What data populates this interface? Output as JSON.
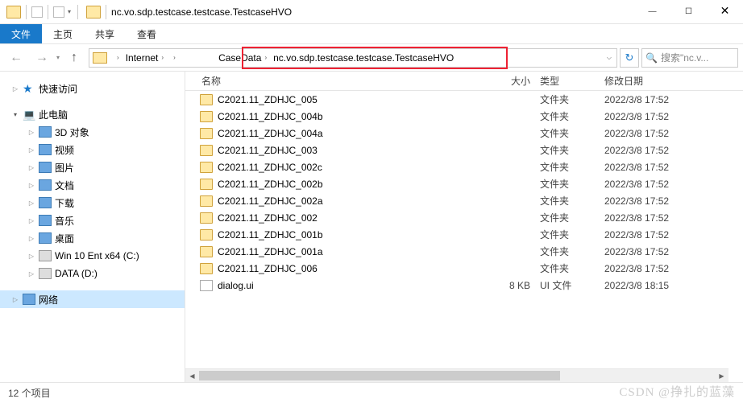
{
  "title": "nc.vo.sdp.testcase.testcase.TestcaseHVO",
  "ribbon": {
    "file": "文件",
    "home": "主页",
    "share": "共享",
    "view": "查看"
  },
  "breadcrumbs": {
    "internet": "Internet",
    "caseData": "CaseData",
    "testcase": "nc.vo.sdp.testcase.testcase.TestcaseHVO"
  },
  "search": {
    "placeholder": "搜索\"nc.v..."
  },
  "sidebar": {
    "quick": "快速访问",
    "pc": "此电脑",
    "items": [
      {
        "label": "3D 对象"
      },
      {
        "label": "视频"
      },
      {
        "label": "图片"
      },
      {
        "label": "文档"
      },
      {
        "label": "下载"
      },
      {
        "label": "音乐"
      },
      {
        "label": "桌面"
      },
      {
        "label": "Win 10 Ent x64 (C:)"
      },
      {
        "label": "DATA (D:)"
      }
    ],
    "network": "网络"
  },
  "headers": {
    "name": "名称",
    "size": "大小",
    "type": "类型",
    "date": "修改日期"
  },
  "files": [
    {
      "name": "C2021.11_ZDHJC_005",
      "size": "",
      "type": "文件夹",
      "date": "2022/3/8 17:52",
      "kind": "fldr"
    },
    {
      "name": "C2021.11_ZDHJC_004b",
      "size": "",
      "type": "文件夹",
      "date": "2022/3/8 17:52",
      "kind": "fldr"
    },
    {
      "name": "C2021.11_ZDHJC_004a",
      "size": "",
      "type": "文件夹",
      "date": "2022/3/8 17:52",
      "kind": "fldr"
    },
    {
      "name": "C2021.11_ZDHJC_003",
      "size": "",
      "type": "文件夹",
      "date": "2022/3/8 17:52",
      "kind": "fldr"
    },
    {
      "name": "C2021.11_ZDHJC_002c",
      "size": "",
      "type": "文件夹",
      "date": "2022/3/8 17:52",
      "kind": "fldr"
    },
    {
      "name": "C2021.11_ZDHJC_002b",
      "size": "",
      "type": "文件夹",
      "date": "2022/3/8 17:52",
      "kind": "fldr"
    },
    {
      "name": "C2021.11_ZDHJC_002a",
      "size": "",
      "type": "文件夹",
      "date": "2022/3/8 17:52",
      "kind": "fldr"
    },
    {
      "name": "C2021.11_ZDHJC_002",
      "size": "",
      "type": "文件夹",
      "date": "2022/3/8 17:52",
      "kind": "fldr"
    },
    {
      "name": "C2021.11_ZDHJC_001b",
      "size": "",
      "type": "文件夹",
      "date": "2022/3/8 17:52",
      "kind": "fldr"
    },
    {
      "name": "C2021.11_ZDHJC_001a",
      "size": "",
      "type": "文件夹",
      "date": "2022/3/8 17:52",
      "kind": "fldr"
    },
    {
      "name": "C2021.11_ZDHJC_006",
      "size": "",
      "type": "文件夹",
      "date": "2022/3/8 17:52",
      "kind": "fldr"
    },
    {
      "name": "dialog.ui",
      "size": "8 KB",
      "type": "UI 文件",
      "date": "2022/3/8 18:15",
      "kind": "file"
    }
  ],
  "status": "12 个项目",
  "watermark": "CSDN @挣扎的蓝藻"
}
